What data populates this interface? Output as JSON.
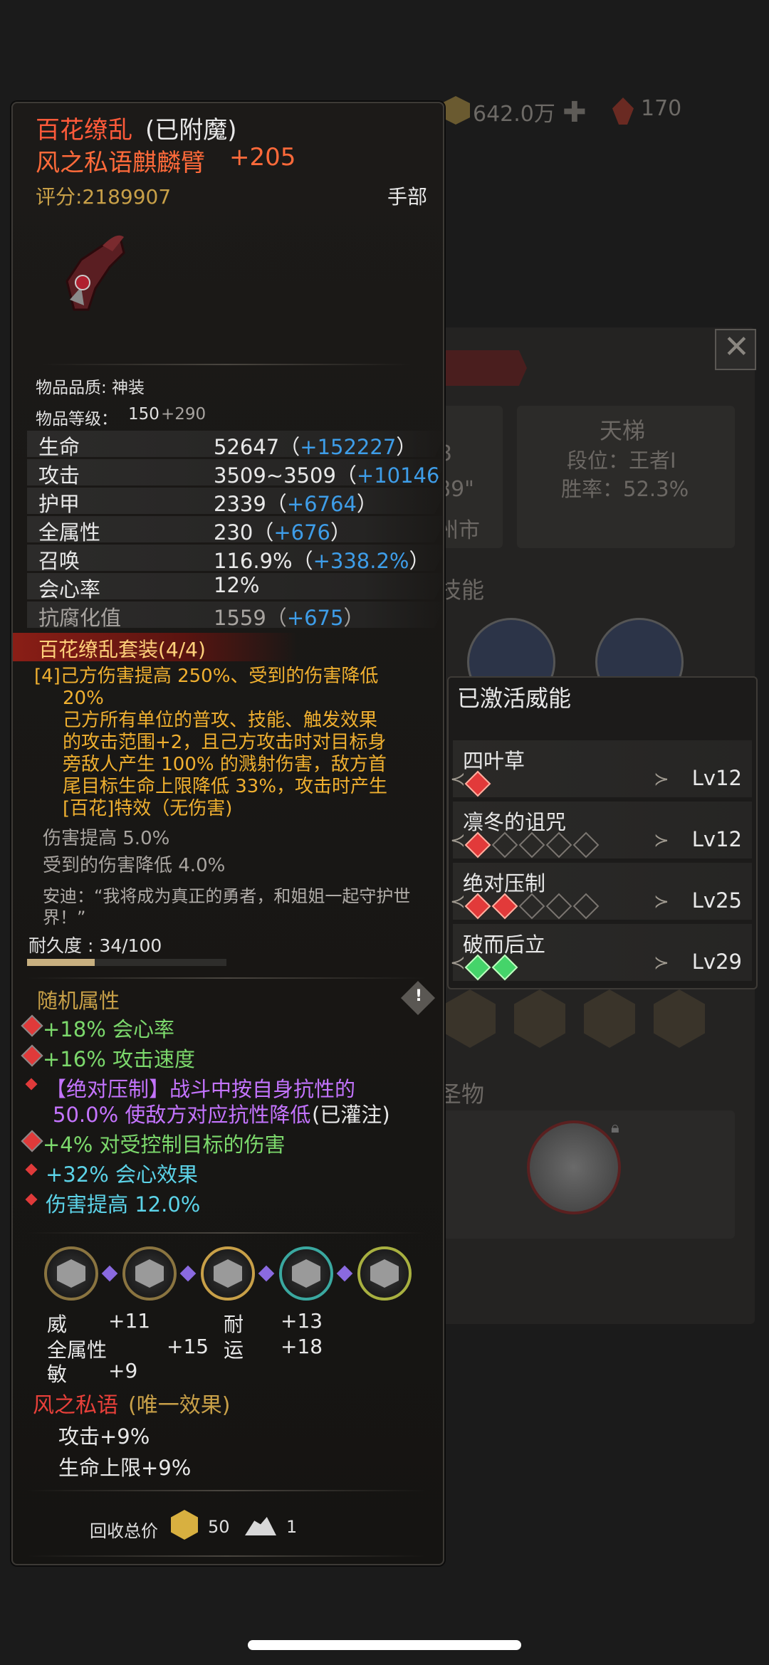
{
  "topbar": {
    "gold_amount": "642.0万",
    "gem_amount": "170"
  },
  "background": {
    "ladder": {
      "title": "天梯",
      "rank": "段位：王者Ⅰ",
      "winrate": "胜率：52.3%"
    },
    "left_card": {
      "line1": "3",
      "line2": "89\"",
      "line3": "州市"
    },
    "skills_header": "技能",
    "relic_header": "圣物"
  },
  "item": {
    "set_name": "百花缭乱",
    "enchant": "(已附魔)",
    "name": "风之私语麒麟臂",
    "plus": "+205",
    "score": "评分:2189907",
    "slot": "手部",
    "quality": "物品品质: 神装",
    "level_label": "物品等级：",
    "level_base": "150",
    "level_bonus": "+290",
    "stats": [
      {
        "label": "生命",
        "base": "52647（",
        "bonus": "+152227",
        "tail": "）"
      },
      {
        "label": "攻击",
        "base": "3509~3509（",
        "bonus": "+10146-",
        "tail": ""
      },
      {
        "label": "护甲",
        "base": "2339（",
        "bonus": "+6764",
        "tail": "）"
      },
      {
        "label": "全属性",
        "base": "230（",
        "bonus": "+676",
        "tail": "）"
      },
      {
        "label": "召唤",
        "base": "116.9%（",
        "bonus": "+338.2%",
        "tail": "）"
      },
      {
        "label": "会心率",
        "base": "12%",
        "bonus": "",
        "tail": ""
      },
      {
        "label": "抗腐化值",
        "base": "1559（",
        "bonus": "+675",
        "tail": "）"
      }
    ],
    "set_title": "百花缭乱套装(4/4)",
    "set_desc": [
      "[4]己方伤害提高 250%、受到的伤害降低",
      "20%",
      "己方所有单位的普攻、技能、触发效果",
      "的攻击范围+2，且己方攻击时对目标身",
      "旁敌人产生 100% 的溅射伤害，敌方首",
      "尾目标生命上限降低 33%，攻击时产生",
      "[百花]特效（无伤害)"
    ],
    "extra1": "伤害提高 5.0%",
    "extra2": "受到的伤害降低 4.0%",
    "quote1": "安迪：“我将成为真正的勇者，和姐姐一起守护世",
    "quote2": "界！”",
    "durability": "耐久度 : 34/100",
    "durability_value": 0.34,
    "random_title": "随机属性",
    "random": [
      {
        "text": "+18% 会心率",
        "color": "green"
      },
      {
        "text": "+16% 攻击速度",
        "color": "green"
      },
      {
        "text": "【绝对压制】战斗中按自身抗性的",
        "color": "purple"
      },
      {
        "text": "50.0% 使敌方对应抗性降低",
        "color": "purple",
        "suffix": "(已灌注)"
      },
      {
        "text": "+4% 对受控制目标的伤害",
        "color": "green"
      },
      {
        "text": "+32% 会心效果",
        "color": "cyan"
      },
      {
        "text": "伤害提高 12.0%",
        "color": "cyan"
      }
    ],
    "runes": [
      {
        "a": "威",
        "av": "+11",
        "b": "耐",
        "bv": "+13"
      },
      {
        "a": "全属性",
        "av": "+15",
        "b": "运",
        "bv": "+18"
      },
      {
        "a": "敏",
        "av": "+9",
        "b": "",
        "bv": ""
      }
    ],
    "unique_title": "风之私语",
    "unique_tag": "(唯一效果)",
    "unique_lines": [
      "攻击+9%",
      "生命上限+9%"
    ],
    "recycle_label": "回收总价",
    "recycle_gold": "50",
    "recycle_dust": "1"
  },
  "popup": {
    "title": "已激活威能",
    "skills": [
      {
        "name": "四叶草",
        "lv": "Lv12",
        "gems": [
          "red"
        ]
      },
      {
        "name": "凛冬的诅咒",
        "lv": "Lv12",
        "gems": [
          "red",
          "empty",
          "empty",
          "empty",
          "empty"
        ]
      },
      {
        "name": "绝对压制",
        "lv": "Lv25",
        "gems": [
          "red",
          "red",
          "empty",
          "empty",
          "empty"
        ]
      },
      {
        "name": "破而后立",
        "lv": "Lv29",
        "gems": [
          "green",
          "green"
        ]
      }
    ]
  },
  "colors": {
    "set_name": "#ff5a3a",
    "name": "#ff6a3a",
    "score": "#c8a048",
    "bonus": "#3e9de8"
  }
}
